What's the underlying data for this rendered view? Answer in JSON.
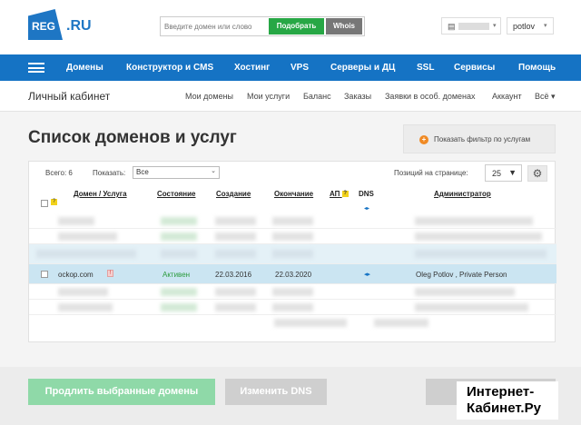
{
  "header": {
    "logo_text": "REG",
    "logo_suffix": ".RU",
    "search_placeholder": "Введите домен или слово",
    "pick_button": "Подобрать",
    "whois_button": "Whois",
    "wallet_icon": "wallet-icon",
    "user_name": "potlov"
  },
  "nav": {
    "items": [
      "Домены",
      "Конструктор и CMS",
      "Хостинг",
      "VPS",
      "Серверы и ДЦ",
      "SSL",
      "Сервисы",
      "Помощь"
    ]
  },
  "subnav": {
    "title": "Личный кабинет",
    "items": [
      "Мои домены",
      "Мои услуги",
      "Баланс",
      "Заказы",
      "Заявки в особ. доменах",
      "Аккаунт",
      "Всё ▾"
    ]
  },
  "page": {
    "title": "Список доменов и услуг",
    "filter_button": "Показать фильтр по услугам"
  },
  "table": {
    "total": "Всего: 6",
    "show_label": "Показать:",
    "show_value": "Все",
    "perpage_label": "Позиций на странице:",
    "perpage_value": "25",
    "columns": {
      "domain": "Домен / Услуга",
      "status": "Состояние",
      "created": "Создание",
      "expires": "Окончание",
      "ap": "АП",
      "dns": "DNS",
      "admin": "Администратор"
    },
    "selected_row": {
      "domain": "ockop.com",
      "status": "Активен",
      "created": "22.03.2016",
      "expires": "22.03.2020",
      "admin": "Oleg Potlov , Private Person"
    }
  },
  "footer": {
    "renew_button": "Продлить выбранные домены",
    "dns_button": "Изменить DNS"
  },
  "watermark": {
    "line1": "Интернет-",
    "line2": "Кабинет.Ру"
  }
}
